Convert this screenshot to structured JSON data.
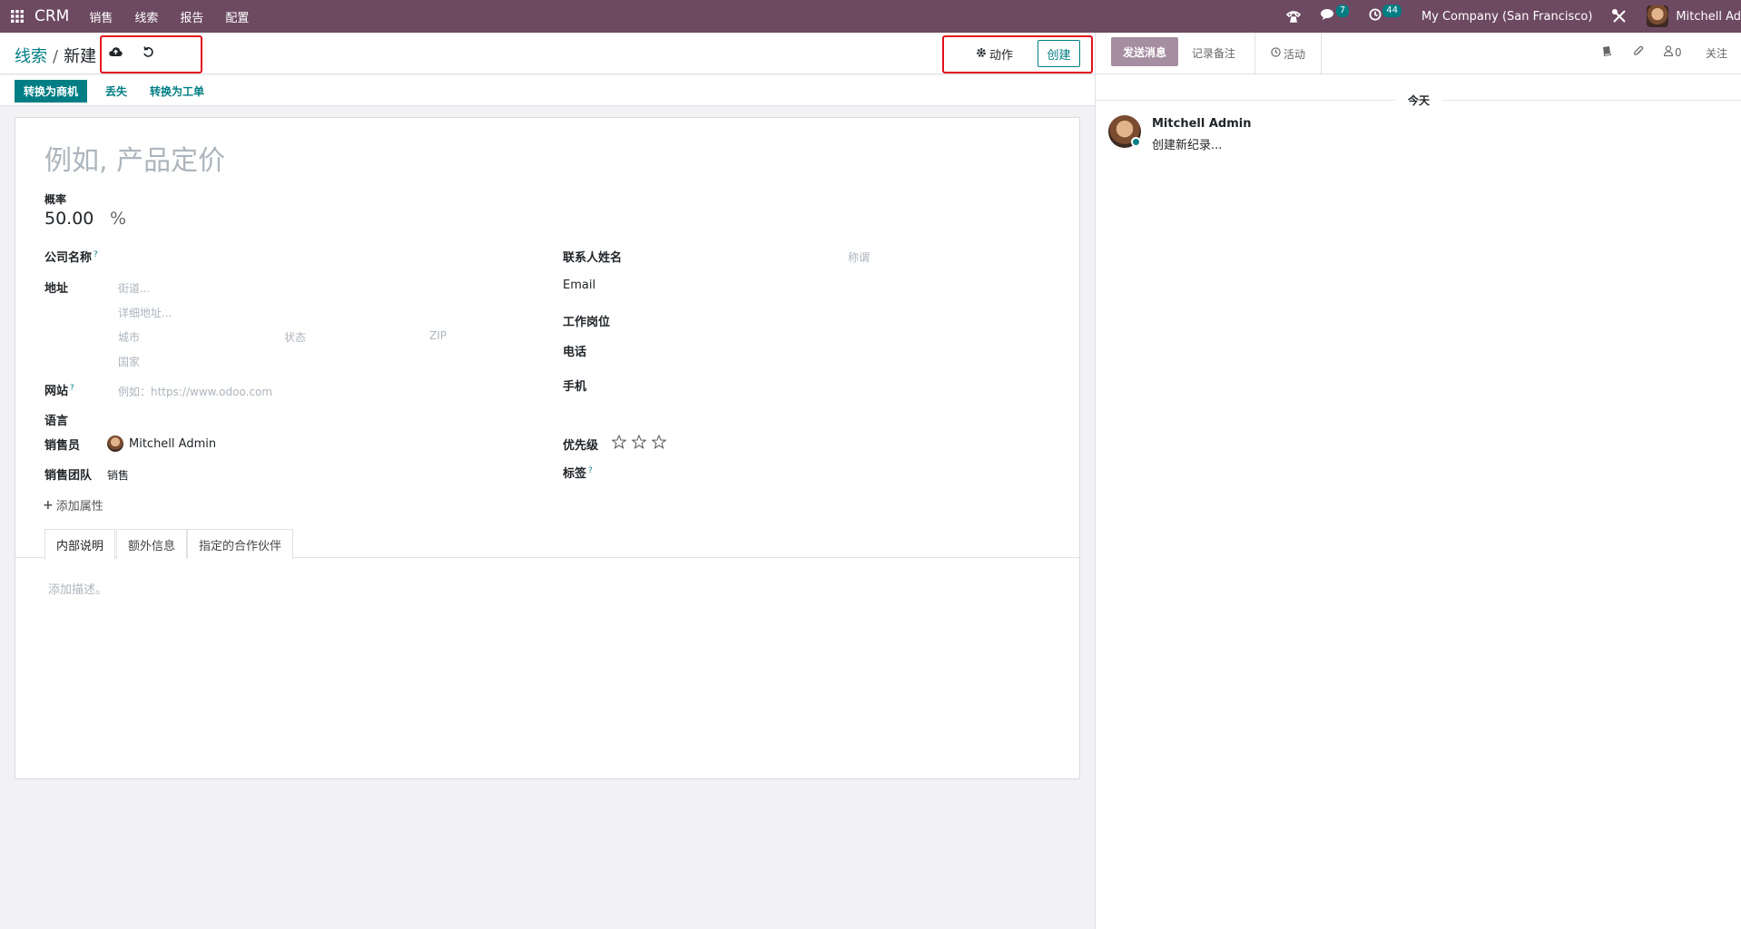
{
  "topbar": {
    "app_name": "CRM",
    "menus": [
      "销售",
      "线索",
      "报告",
      "配置"
    ],
    "messages_count": "7",
    "activities_count": "44",
    "company": "My Company (San Francisco)",
    "user": "Mitchell Ad"
  },
  "breadcrumb": {
    "parent": "线索",
    "current": "新建"
  },
  "toolbar": {
    "action_label": "动作",
    "create_label": "创建"
  },
  "statusbar": {
    "convert_opportunity": "转换为商机",
    "lost": "丢失",
    "convert_ticket": "转换为工单"
  },
  "form": {
    "title_placeholder": "例如, 产品定价",
    "probability_label": "概率",
    "probability_value": "50.00",
    "probability_unit": "%",
    "company_name_label": "公司名称",
    "address_label": "地址",
    "street_placeholder": "街道...",
    "street2_placeholder": "详细地址...",
    "city_placeholder": "城市",
    "state_placeholder": "状态",
    "zip_placeholder": "ZIP",
    "country_placeholder": "国家",
    "website_label": "网站",
    "website_placeholder": "例如：https://www.odoo.com",
    "language_label": "语言",
    "salesperson_label": "销售员",
    "salesperson_value": "Mitchell Admin",
    "sales_team_label": "销售团队",
    "sales_team_value": "销售",
    "add_property": "添加属性",
    "contact_name_label": "联系人姓名",
    "title_ph": "称谓",
    "email_label": "Email",
    "job_label": "工作岗位",
    "phone_label": "电话",
    "mobile_label": "手机",
    "priority_label": "优先级",
    "priority_stars": 0,
    "tags_label": "标签",
    "help_mark": "?"
  },
  "tabs": [
    "内部说明",
    "额外信息",
    "指定的合作伙伴"
  ],
  "description_placeholder": "添加描述。",
  "chatter": {
    "send_message": "发送消息",
    "log_note": "记录备注",
    "activity": "活动",
    "followers_count": "0",
    "follow": "关注",
    "today": "今天",
    "message_author": "Mitchell Admin",
    "message_body": "创建新纪录..."
  },
  "colors": {
    "brand": "#6d4a62",
    "accent": "#017e84",
    "highlight": "#e3101e"
  }
}
